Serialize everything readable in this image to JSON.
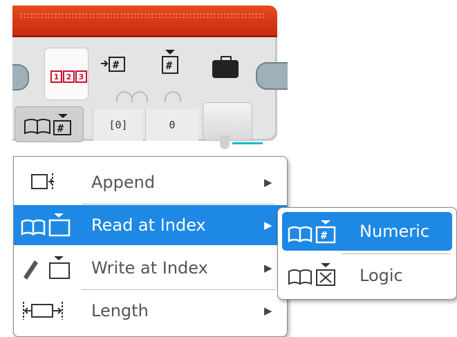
{
  "block": {
    "mode_icon": "numeric-array-icon",
    "mode_digits": [
      "1",
      "2",
      "3"
    ],
    "inputs": [
      {
        "name": "array",
        "icon": "array-in-icon",
        "value": "[0]"
      },
      {
        "name": "index",
        "icon": "index-icon",
        "value": "0"
      },
      {
        "name": "output",
        "icon": "toolbox-icon",
        "value": ""
      }
    ],
    "colors": {
      "header": "#d7361a",
      "body": "#e4e4e4",
      "plug": "#9fb0b8"
    }
  },
  "menu": {
    "items": [
      {
        "label": "Append",
        "icon": "append-icon",
        "submenu": true
      },
      {
        "label": "Read at Index",
        "icon": "read-at-index-icon",
        "submenu": true,
        "active": true
      },
      {
        "label": "Write at Index",
        "icon": "write-at-index-icon",
        "submenu": true
      },
      {
        "label": "Length",
        "icon": "length-icon",
        "submenu": true
      }
    ],
    "arrow": "▶"
  },
  "submenu": {
    "items": [
      {
        "label": "Numeric",
        "icon": "numeric-read-icon",
        "active": true
      },
      {
        "label": "Logic",
        "icon": "logic-read-icon"
      }
    ]
  },
  "accent_color": "#1e88e5"
}
